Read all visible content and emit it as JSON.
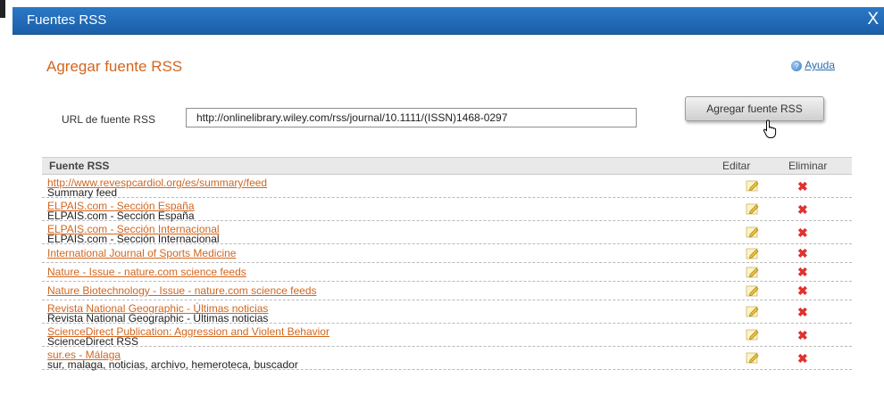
{
  "dialog": {
    "title": "Fuentes RSS",
    "close_label": "X"
  },
  "section": {
    "title": "Agregar fuente RSS"
  },
  "help": {
    "label": "Ayuda",
    "icon": "help-icon"
  },
  "form": {
    "url_label": "URL de fuente RSS",
    "url_value": "http://onlinelibrary.wiley.com/rss/journal/10.1111/(ISSN)1468-0297",
    "add_button": "Agregar fuente RSS"
  },
  "table": {
    "headers": {
      "source": "Fuente RSS",
      "edit": "Editar",
      "delete": "Eliminar"
    },
    "rows": [
      {
        "link": "http://www.revespcardiol.org/es/summary/feed",
        "desc": "Summary feed"
      },
      {
        "link": "ELPAIS.com - Sección España",
        "desc": "ELPAIS.com - Sección España"
      },
      {
        "link": "ELPAIS.com - Sección Internacional",
        "desc": "ELPAIS.com - Sección Internacional"
      },
      {
        "link": "International Journal of Sports Medicine",
        "desc": ""
      },
      {
        "link": "Nature - Issue - nature.com science feeds",
        "desc": ""
      },
      {
        "link": "Nature Biotechnology - Issue - nature.com science feeds",
        "desc": ""
      },
      {
        "link": "Revista National Geographic - Últimas noticias",
        "desc": "Revista National Geographic - Últimas noticias"
      },
      {
        "link": "ScienceDirect Publication: Aggression and Violent Behavior",
        "desc": "ScienceDirect RSS"
      },
      {
        "link": "sur.es - Málaga",
        "desc": "sur, malaga, noticias, archivo, hemeroteca, buscador"
      }
    ]
  },
  "icons": {
    "edit": "pencil-icon",
    "delete": "delete-x-icon",
    "cursor": "hand-cursor-icon"
  },
  "colors": {
    "titlebar": "#1f66b1",
    "accent": "#d2661f",
    "link": "#2b6cb0",
    "delete": "#e0322f"
  }
}
